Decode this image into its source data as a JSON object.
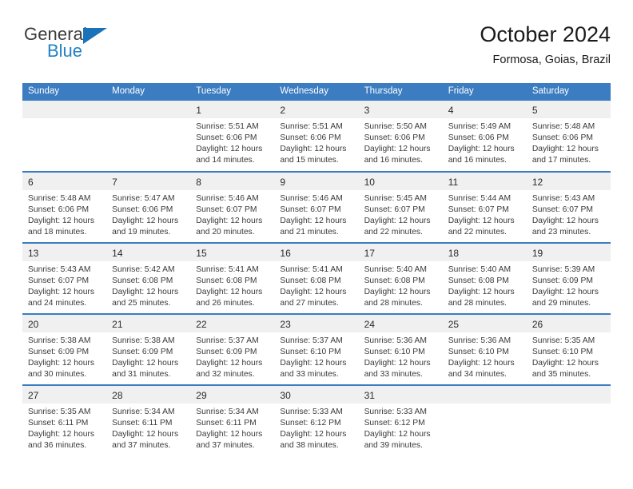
{
  "brand": {
    "name_top": "General",
    "name_bottom": "Blue",
    "triangle_color": "#1a72b8",
    "top_color": "#3c3c3c",
    "bottom_color": "#2282c5"
  },
  "header": {
    "title": "October 2024",
    "subtitle": "Formosa, Goias, Brazil"
  },
  "theme": {
    "header_bg": "#3b7dc0",
    "header_text": "#ffffff",
    "daynum_bg": "#f0f0f0",
    "row_divider": "#3b7dc0",
    "body_text": "#3a3a3a"
  },
  "weekday_headers": [
    "Sunday",
    "Monday",
    "Tuesday",
    "Wednesday",
    "Thursday",
    "Friday",
    "Saturday"
  ],
  "labels": {
    "sunrise_prefix": "Sunrise:",
    "sunset_prefix": "Sunset:",
    "daylight_prefix": "Daylight:"
  },
  "weeks": [
    [
      {
        "day": "",
        "empty": true
      },
      {
        "day": "",
        "empty": true
      },
      {
        "day": "1",
        "sunrise": "Sunrise: 5:51 AM",
        "sunset": "Sunset: 6:06 PM",
        "daylight_1": "Daylight: 12 hours",
        "daylight_2": "and 14 minutes."
      },
      {
        "day": "2",
        "sunrise": "Sunrise: 5:51 AM",
        "sunset": "Sunset: 6:06 PM",
        "daylight_1": "Daylight: 12 hours",
        "daylight_2": "and 15 minutes."
      },
      {
        "day": "3",
        "sunrise": "Sunrise: 5:50 AM",
        "sunset": "Sunset: 6:06 PM",
        "daylight_1": "Daylight: 12 hours",
        "daylight_2": "and 16 minutes."
      },
      {
        "day": "4",
        "sunrise": "Sunrise: 5:49 AM",
        "sunset": "Sunset: 6:06 PM",
        "daylight_1": "Daylight: 12 hours",
        "daylight_2": "and 16 minutes."
      },
      {
        "day": "5",
        "sunrise": "Sunrise: 5:48 AM",
        "sunset": "Sunset: 6:06 PM",
        "daylight_1": "Daylight: 12 hours",
        "daylight_2": "and 17 minutes."
      }
    ],
    [
      {
        "day": "6",
        "sunrise": "Sunrise: 5:48 AM",
        "sunset": "Sunset: 6:06 PM",
        "daylight_1": "Daylight: 12 hours",
        "daylight_2": "and 18 minutes."
      },
      {
        "day": "7",
        "sunrise": "Sunrise: 5:47 AM",
        "sunset": "Sunset: 6:06 PM",
        "daylight_1": "Daylight: 12 hours",
        "daylight_2": "and 19 minutes."
      },
      {
        "day": "8",
        "sunrise": "Sunrise: 5:46 AM",
        "sunset": "Sunset: 6:07 PM",
        "daylight_1": "Daylight: 12 hours",
        "daylight_2": "and 20 minutes."
      },
      {
        "day": "9",
        "sunrise": "Sunrise: 5:46 AM",
        "sunset": "Sunset: 6:07 PM",
        "daylight_1": "Daylight: 12 hours",
        "daylight_2": "and 21 minutes."
      },
      {
        "day": "10",
        "sunrise": "Sunrise: 5:45 AM",
        "sunset": "Sunset: 6:07 PM",
        "daylight_1": "Daylight: 12 hours",
        "daylight_2": "and 22 minutes."
      },
      {
        "day": "11",
        "sunrise": "Sunrise: 5:44 AM",
        "sunset": "Sunset: 6:07 PM",
        "daylight_1": "Daylight: 12 hours",
        "daylight_2": "and 22 minutes."
      },
      {
        "day": "12",
        "sunrise": "Sunrise: 5:43 AM",
        "sunset": "Sunset: 6:07 PM",
        "daylight_1": "Daylight: 12 hours",
        "daylight_2": "and 23 minutes."
      }
    ],
    [
      {
        "day": "13",
        "sunrise": "Sunrise: 5:43 AM",
        "sunset": "Sunset: 6:07 PM",
        "daylight_1": "Daylight: 12 hours",
        "daylight_2": "and 24 minutes."
      },
      {
        "day": "14",
        "sunrise": "Sunrise: 5:42 AM",
        "sunset": "Sunset: 6:08 PM",
        "daylight_1": "Daylight: 12 hours",
        "daylight_2": "and 25 minutes."
      },
      {
        "day": "15",
        "sunrise": "Sunrise: 5:41 AM",
        "sunset": "Sunset: 6:08 PM",
        "daylight_1": "Daylight: 12 hours",
        "daylight_2": "and 26 minutes."
      },
      {
        "day": "16",
        "sunrise": "Sunrise: 5:41 AM",
        "sunset": "Sunset: 6:08 PM",
        "daylight_1": "Daylight: 12 hours",
        "daylight_2": "and 27 minutes."
      },
      {
        "day": "17",
        "sunrise": "Sunrise: 5:40 AM",
        "sunset": "Sunset: 6:08 PM",
        "daylight_1": "Daylight: 12 hours",
        "daylight_2": "and 28 minutes."
      },
      {
        "day": "18",
        "sunrise": "Sunrise: 5:40 AM",
        "sunset": "Sunset: 6:08 PM",
        "daylight_1": "Daylight: 12 hours",
        "daylight_2": "and 28 minutes."
      },
      {
        "day": "19",
        "sunrise": "Sunrise: 5:39 AM",
        "sunset": "Sunset: 6:09 PM",
        "daylight_1": "Daylight: 12 hours",
        "daylight_2": "and 29 minutes."
      }
    ],
    [
      {
        "day": "20",
        "sunrise": "Sunrise: 5:38 AM",
        "sunset": "Sunset: 6:09 PM",
        "daylight_1": "Daylight: 12 hours",
        "daylight_2": "and 30 minutes."
      },
      {
        "day": "21",
        "sunrise": "Sunrise: 5:38 AM",
        "sunset": "Sunset: 6:09 PM",
        "daylight_1": "Daylight: 12 hours",
        "daylight_2": "and 31 minutes."
      },
      {
        "day": "22",
        "sunrise": "Sunrise: 5:37 AM",
        "sunset": "Sunset: 6:09 PM",
        "daylight_1": "Daylight: 12 hours",
        "daylight_2": "and 32 minutes."
      },
      {
        "day": "23",
        "sunrise": "Sunrise: 5:37 AM",
        "sunset": "Sunset: 6:10 PM",
        "daylight_1": "Daylight: 12 hours",
        "daylight_2": "and 33 minutes."
      },
      {
        "day": "24",
        "sunrise": "Sunrise: 5:36 AM",
        "sunset": "Sunset: 6:10 PM",
        "daylight_1": "Daylight: 12 hours",
        "daylight_2": "and 33 minutes."
      },
      {
        "day": "25",
        "sunrise": "Sunrise: 5:36 AM",
        "sunset": "Sunset: 6:10 PM",
        "daylight_1": "Daylight: 12 hours",
        "daylight_2": "and 34 minutes."
      },
      {
        "day": "26",
        "sunrise": "Sunrise: 5:35 AM",
        "sunset": "Sunset: 6:10 PM",
        "daylight_1": "Daylight: 12 hours",
        "daylight_2": "and 35 minutes."
      }
    ],
    [
      {
        "day": "27",
        "sunrise": "Sunrise: 5:35 AM",
        "sunset": "Sunset: 6:11 PM",
        "daylight_1": "Daylight: 12 hours",
        "daylight_2": "and 36 minutes."
      },
      {
        "day": "28",
        "sunrise": "Sunrise: 5:34 AM",
        "sunset": "Sunset: 6:11 PM",
        "daylight_1": "Daylight: 12 hours",
        "daylight_2": "and 37 minutes."
      },
      {
        "day": "29",
        "sunrise": "Sunrise: 5:34 AM",
        "sunset": "Sunset: 6:11 PM",
        "daylight_1": "Daylight: 12 hours",
        "daylight_2": "and 37 minutes."
      },
      {
        "day": "30",
        "sunrise": "Sunrise: 5:33 AM",
        "sunset": "Sunset: 6:12 PM",
        "daylight_1": "Daylight: 12 hours",
        "daylight_2": "and 38 minutes."
      },
      {
        "day": "31",
        "sunrise": "Sunrise: 5:33 AM",
        "sunset": "Sunset: 6:12 PM",
        "daylight_1": "Daylight: 12 hours",
        "daylight_2": "and 39 minutes."
      },
      {
        "day": "",
        "empty": true
      },
      {
        "day": "",
        "empty": true
      }
    ]
  ]
}
